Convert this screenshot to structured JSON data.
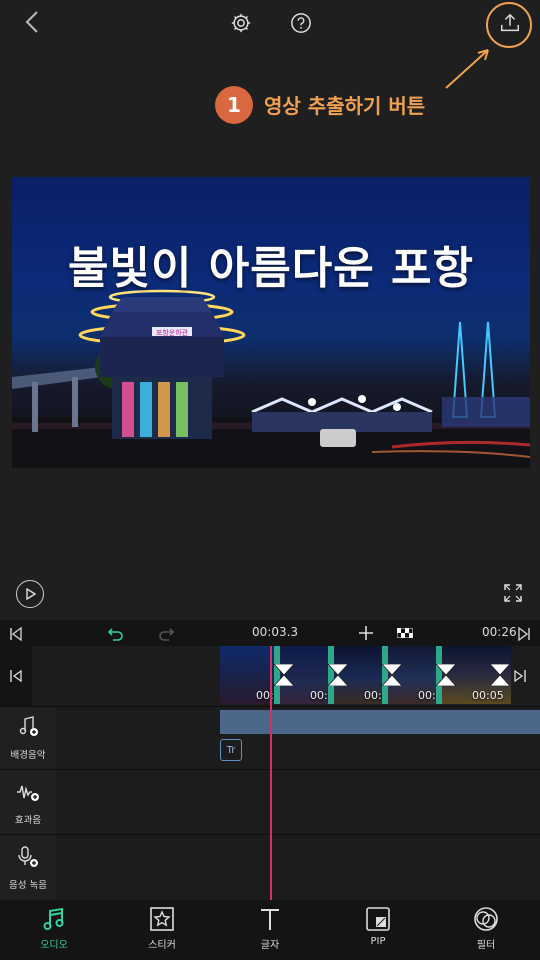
{
  "topbar": {
    "back_icon": "chevron-left-icon",
    "settings_icon": "gear-icon",
    "help_icon": "question-icon",
    "export_icon": "export-upload-icon"
  },
  "callout": {
    "number": "1",
    "text": "영상 추출하기 버튼",
    "color": "#f0a050"
  },
  "preview": {
    "title": "불빛이 아름다운 포항",
    "sign_text": "포항운하관"
  },
  "player": {
    "play_icon": "play-icon",
    "fullscreen_icon": "fullscreen-icon"
  },
  "timeline": {
    "current_time": "00:03.3",
    "total_time": "00:26",
    "clip_durations": [
      "00:05",
      "00:05",
      "00:05",
      "00:05",
      "00:05"
    ],
    "text_clip_label": "Tr"
  },
  "lanes": [
    {
      "label": "배경음악",
      "icon": "music-note-add-icon"
    },
    {
      "label": "효과음",
      "icon": "waveform-add-icon"
    },
    {
      "label": "음성 녹음",
      "icon": "microphone-add-icon"
    }
  ],
  "nav": [
    {
      "label": "오디오",
      "icon": "music-icon",
      "active": true
    },
    {
      "label": "스티커",
      "icon": "sticker-icon",
      "active": false
    },
    {
      "label": "글자",
      "icon": "text-icon",
      "active": false
    },
    {
      "label": "PIP",
      "icon": "pip-icon",
      "active": false
    },
    {
      "label": "필터",
      "icon": "filter-icon",
      "active": false
    }
  ],
  "colors": {
    "accent": "#2fd3a2",
    "playhead": "#d1326b",
    "callout": "#f0a050",
    "badge": "#d9673f",
    "audio_track": "#4b6789"
  }
}
